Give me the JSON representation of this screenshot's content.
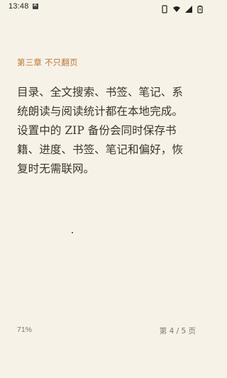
{
  "status_bar": {
    "time": "13:48"
  },
  "reader": {
    "chapter_title": "第三章 不只翻页",
    "body_text": "目录、全文搜索、书签、笔记、系统朗读与阅读统计都在本地完成。设置中的 ZIP 备份会同时保存书籍、进度、书签、笔记和偏好，恢复时无需联网。",
    "progress_percent": "71%",
    "page_indicator": "第 4 / 5 页"
  },
  "colors": {
    "background": "#f7f2e7",
    "accent": "#b9783a",
    "text": "#3d342c",
    "muted": "#7b7671"
  },
  "icons": [
    "keyboard-icon",
    "phone-icon",
    "wifi-icon",
    "signal-icon",
    "battery-icon"
  ]
}
